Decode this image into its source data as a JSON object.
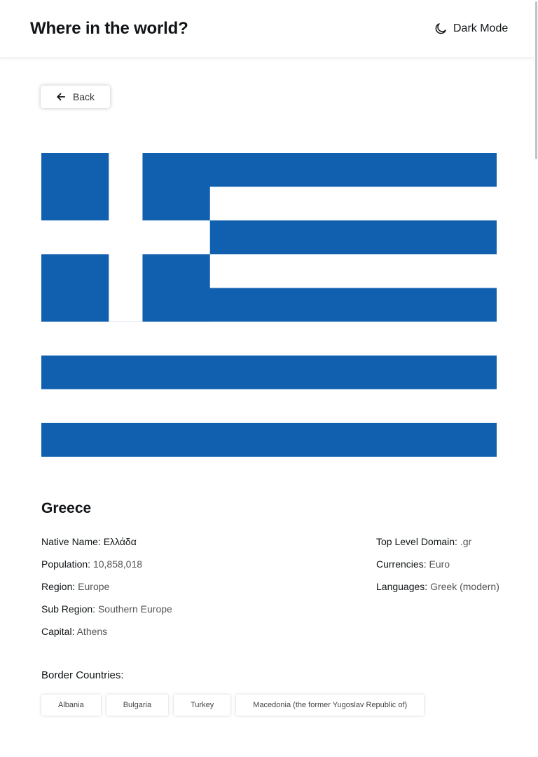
{
  "header": {
    "title": "Where in the world?",
    "theme_toggle_label": "Dark Mode",
    "theme_toggle_icon": "moon-icon"
  },
  "back_button": {
    "label": "Back",
    "icon": "arrow-left-icon"
  },
  "country": {
    "name": "Greece",
    "flag": {
      "colors": {
        "blue": "#1160b0",
        "white": "#ffffff"
      }
    },
    "details_left": [
      {
        "label": "Native Name:",
        "value": "Ελλάδα"
      },
      {
        "label": "Population:",
        "value": "10,858,018"
      },
      {
        "label": "Region:",
        "value": "Europe"
      },
      {
        "label": "Sub Region:",
        "value": "Southern Europe"
      },
      {
        "label": "Capital:",
        "value": "Athens"
      }
    ],
    "details_right": [
      {
        "label": "Top Level Domain:",
        "value": ".gr"
      },
      {
        "label": "Currencies:",
        "value": "Euro"
      },
      {
        "label": "Languages:",
        "value": "Greek (modern)"
      }
    ],
    "border_countries_title": "Border Countries:",
    "border_countries": [
      "Albania",
      "Bulgaria",
      "Turkey",
      "Macedonia (the former Yugoslav Republic of)"
    ]
  }
}
